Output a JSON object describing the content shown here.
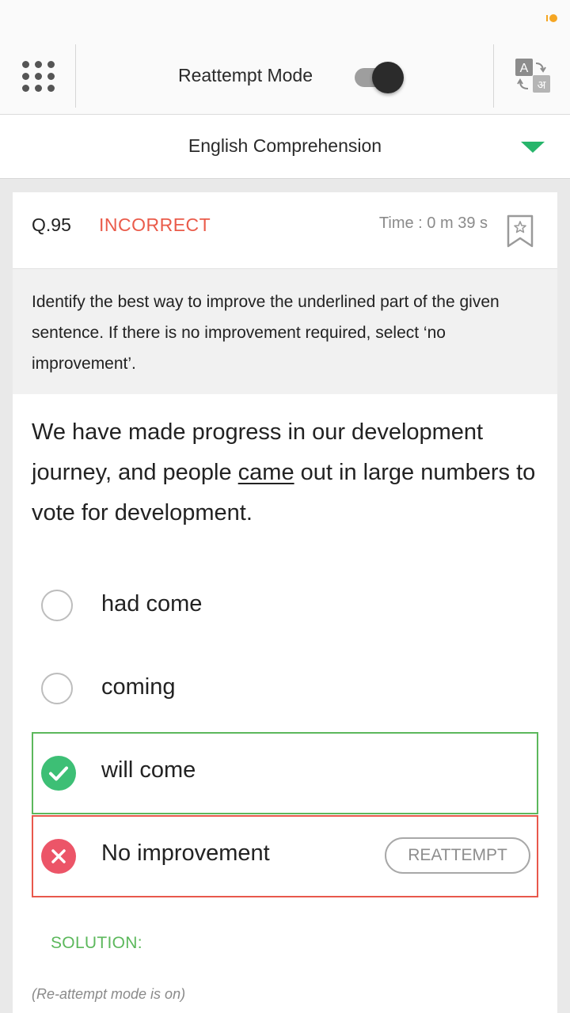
{
  "header": {
    "mode_label": "Reattempt Mode",
    "toggle_on": true
  },
  "section": {
    "title": "English Comprehension"
  },
  "question": {
    "number": "Q.95",
    "status": "INCORRECT",
    "time": "Time : 0 m 39 s",
    "instruction": "Identify the best way to improve the underlined part of the given sentence. If there is no improvement required, select ‘no improvement’.",
    "sentence_before": "We have made progress in our development journey, and people ",
    "sentence_underlined": "came",
    "sentence_after": " out in large numbers to vote for development."
  },
  "options": [
    {
      "label": "had come",
      "state": "unselected"
    },
    {
      "label": "coming",
      "state": "unselected"
    },
    {
      "label": "will come",
      "state": "correct"
    },
    {
      "label": "No improvement",
      "state": "wrong"
    }
  ],
  "reattempt_button": "REATTEMPT",
  "solution": {
    "label": "SOLUTION:",
    "note": "(Re-attempt mode is on)"
  },
  "colors": {
    "correct": "#5cb85c",
    "wrong": "#e8584c",
    "status_incorrect": "#ea5b4a",
    "accent_green": "#27b56b"
  }
}
